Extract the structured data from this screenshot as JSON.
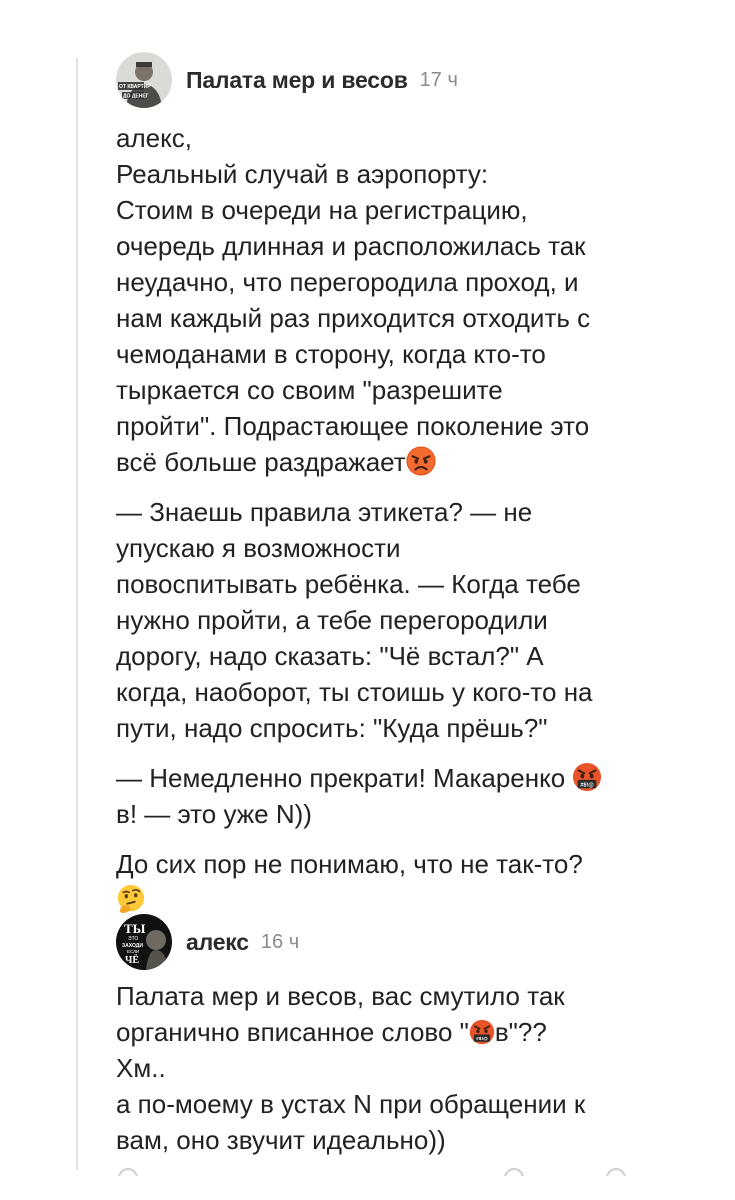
{
  "comments": [
    {
      "author": "Палата мер и весов",
      "time": "17 ч",
      "avatar_text": [
        "ОТ КВАРТИР",
        "ДО ДЕНЕГ"
      ],
      "paragraphs": [
        [
          "алекс,",
          "Реальный случай в аэропорту:",
          "Стоим в очереди на регистрацию,",
          "очередь длинная и расположилась так",
          "неудачно, что перегородила проход, и",
          "нам каждый раз приходится отходить с",
          "чемоданами в сторону, когда кто-то",
          "тыркается со своим \"разрешите",
          "пройти\". Подрастающее поколение это",
          "всё больше раздражает"
        ],
        [
          "— Знаешь правила этикета? — не",
          "упускаю я возможности",
          "повоспитывать ребёнка. — Когда тебе",
          "нужно пройти, а тебе перегородили",
          "дорогу, надо сказать: \"Чё встал?\" А",
          "когда, наоборот, ты стоишь у кого-то на",
          "пути, надо спросить: \"Куда прёшь?\""
        ],
        [
          "— Немедленно прекрати! Макаренко ",
          "в! — это уже N))"
        ],
        [
          "До сих пор не понимаю, что не так-то?"
        ]
      ]
    },
    {
      "author": "алекс",
      "time": "16 ч",
      "avatar_text": [
        "ТЫ",
        "ЭТО",
        "ЗАХОДИ",
        "ЕСЛИ",
        "ЧЁ"
      ],
      "lines": [
        "Палата мер и весов, вас смутило так",
        "органично вписанное слово \"",
        "в\"??",
        "Хм..",
        "а по-моему в устах N при обращении к",
        "вам, оно звучит идеально))"
      ]
    }
  ],
  "emojis": {
    "angry": "angry-face-icon",
    "cursing": "face-with-symbols-on-mouth-icon",
    "thinking": "thinking-face-icon"
  },
  "colors": {
    "text": "#222222",
    "author": "#2c2c2c",
    "time": "#8b8b8b",
    "thread_line": "#e2e2e2"
  }
}
